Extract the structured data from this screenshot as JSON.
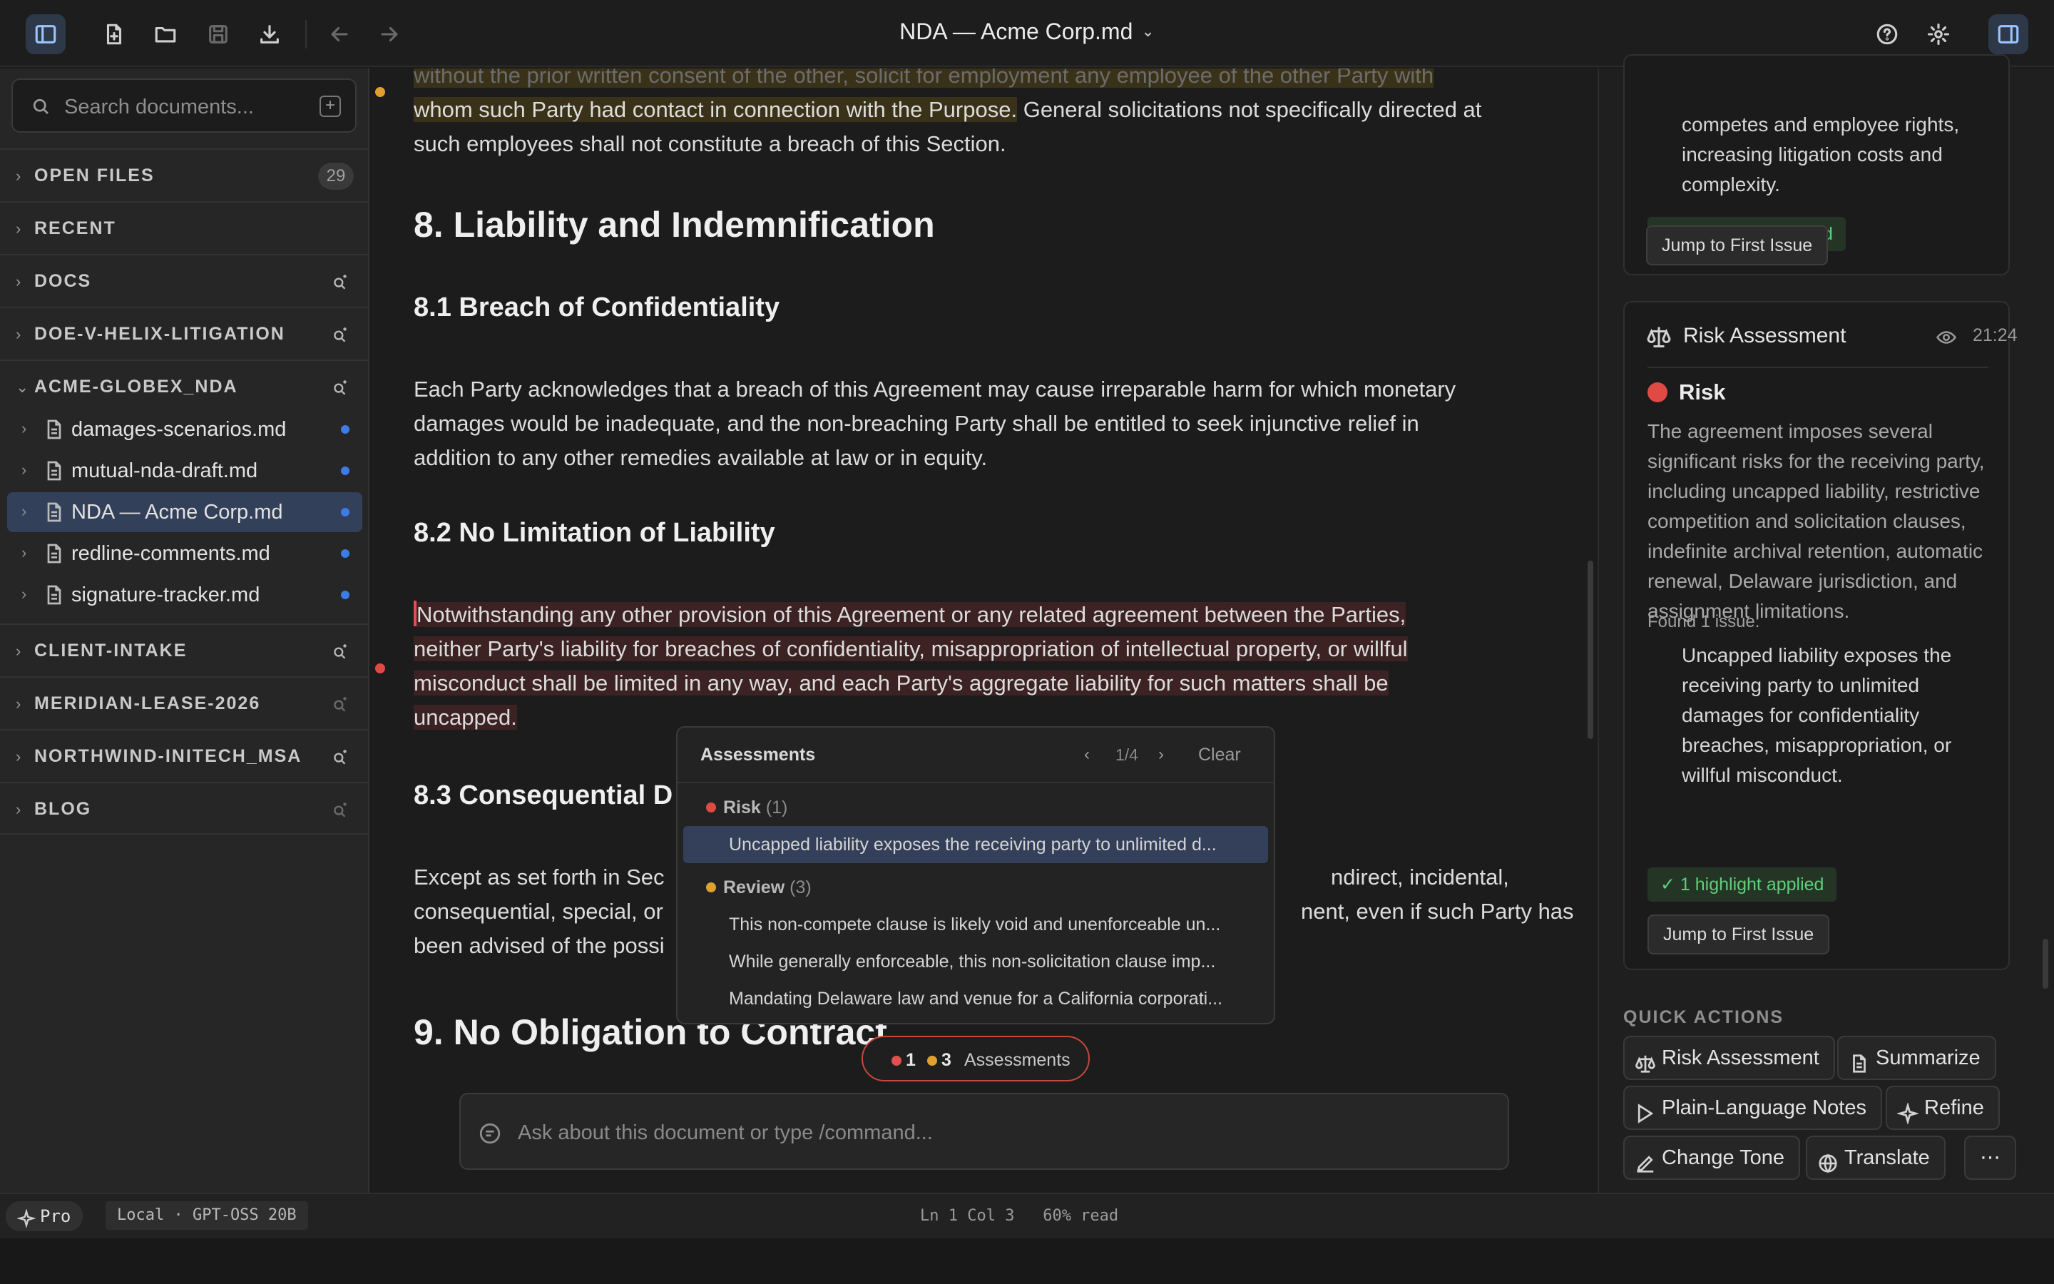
{
  "window": {
    "title": "NDA — Acme Corp.md"
  },
  "toolbar": {
    "toggle_sidebar": "sidebar-icon",
    "new_file": "new-file-icon",
    "open": "folder-icon",
    "save": "save-icon",
    "export": "download-icon",
    "back": "arrow-left-icon",
    "forward": "arrow-right-icon",
    "help": "help-icon",
    "settings": "gear-icon",
    "right_panel": "panel-icon"
  },
  "sidebar": {
    "search_placeholder": "Search documents...",
    "sections": [
      {
        "label": "OPEN FILES",
        "count": "29"
      },
      {
        "label": "RECENT"
      },
      {
        "label": "DOCS"
      },
      {
        "label": "DOE-V-HELIX-LITIGATION"
      },
      {
        "label": "ACME-GLOBEX_NDA",
        "expanded": true
      },
      {
        "label": "CLIENT-INTAKE"
      },
      {
        "label": "MERIDIAN-LEASE-2026"
      },
      {
        "label": "NORTHWIND-INITECH_MSA"
      },
      {
        "label": "BLOG"
      }
    ],
    "files": [
      {
        "name": "damages-scenarios.md"
      },
      {
        "name": "mutual-nda-draft.md"
      },
      {
        "name": "NDA — Acme Corp.md",
        "selected": true
      },
      {
        "name": "redline-comments.md"
      },
      {
        "name": "signature-tracker.md"
      }
    ]
  },
  "editor": {
    "para_top_faded": "without the prior written consent of the other, solicit for employment any employee of the other Party with",
    "para_top_hl": "whom such Party had contact in connection with the Purpose.",
    "para_top_rest": " General solicitations not specifically directed at",
    "para_top_line3": "such employees shall not constitute a breach of this Section.",
    "h_8": "8. Liability and Indemnification",
    "h_8_1": "8.1 Breach of Confidentiality",
    "p_8_1_l1": "Each Party acknowledges that a breach of this Agreement may cause irreparable harm for which monetary",
    "p_8_1_l2": "damages would be inadequate, and the non-breaching Party shall be entitled to seek injunctive relief in",
    "p_8_1_l3": "addition to any other remedies available at law or in equity.",
    "h_8_2": "8.2 No Limitation of Liability",
    "p_8_2_l1": "Notwithstanding any other provision of this Agreement or any related agreement between the Parties,",
    "p_8_2_l2": "neither Party's liability for breaches of confidentiality, misappropriation of intellectual property, or willful",
    "p_8_2_l3": "misconduct shall be limited in any way, and each Party's aggregate liability for such matters shall be",
    "p_8_2_l4": "uncapped.",
    "h_8_3": "8.3 Consequential D",
    "p_8_3_l1a": "Except as set forth in Sec",
    "p_8_3_l1b": "ndirect, incidental,",
    "p_8_3_l2a": "consequential, special, or",
    "p_8_3_l2b": "nent, even if such Party has",
    "p_8_3_l3a": "been advised of the possi",
    "h_9": "9. No Obligation to Contract"
  },
  "assessments_popup": {
    "title": "Assessments",
    "prev": "‹",
    "position": "1/4",
    "next": "›",
    "clear": "Clear",
    "risk_group": "Risk",
    "risk_count": "(1)",
    "risk_items": [
      "Uncapped liability exposes the receiving party to unlimited d..."
    ],
    "review_group": "Review",
    "review_count": "(3)",
    "review_items": [
      "This non-compete clause is likely void and unenforceable un...",
      "While generally enforceable, this non-solicitation clause imp...",
      "Mandating Delaware law and venue for a California corporati..."
    ]
  },
  "assessments_pill": {
    "risk": "1",
    "review": "3",
    "label": "Assessments"
  },
  "ask": {
    "placeholder": "Ask about this document or type /command..."
  },
  "right_panel": {
    "card1": {
      "text_l1": "competes and employee rights,",
      "text_l2": "increasing litigation costs and",
      "text_l3": "complexity.",
      "badge": "✓ 3 highlights applied",
      "jump": "Jump to First Issue"
    },
    "card2": {
      "title": "Risk Assessment",
      "time": "21:24",
      "level": "Risk",
      "summary": "The agreement imposes several significant risks for the receiving party, including uncapped liability, restrictive competition and solicitation clauses, indefinite archival retention, automatic renewal, Delaware jurisdiction, and assignment limitations.",
      "found": "Found 1 issue:",
      "issue": "Uncapped liability exposes the receiving party to unlimited damages for confidentiality breaches, misappropriation, or willful misconduct.",
      "badge": "✓ 1 highlight applied",
      "jump": "Jump to First Issue"
    },
    "quick_actions": {
      "title": "QUICK ACTIONS",
      "risk": "Risk Assessment",
      "summarize": "Summarize",
      "plain": "Plain-Language Notes",
      "refine": "Refine",
      "tone": "Change Tone",
      "translate": "Translate",
      "more": "⋯"
    }
  },
  "status": {
    "plan": "Pro",
    "model": "Local · GPT-OSS 20B",
    "position": "Ln 1 Col 3",
    "read": "60% read"
  },
  "colors": {
    "accent": "#3d7be6",
    "risk": "#e04a44",
    "review": "#e0a030",
    "success": "#5fcf7a"
  }
}
